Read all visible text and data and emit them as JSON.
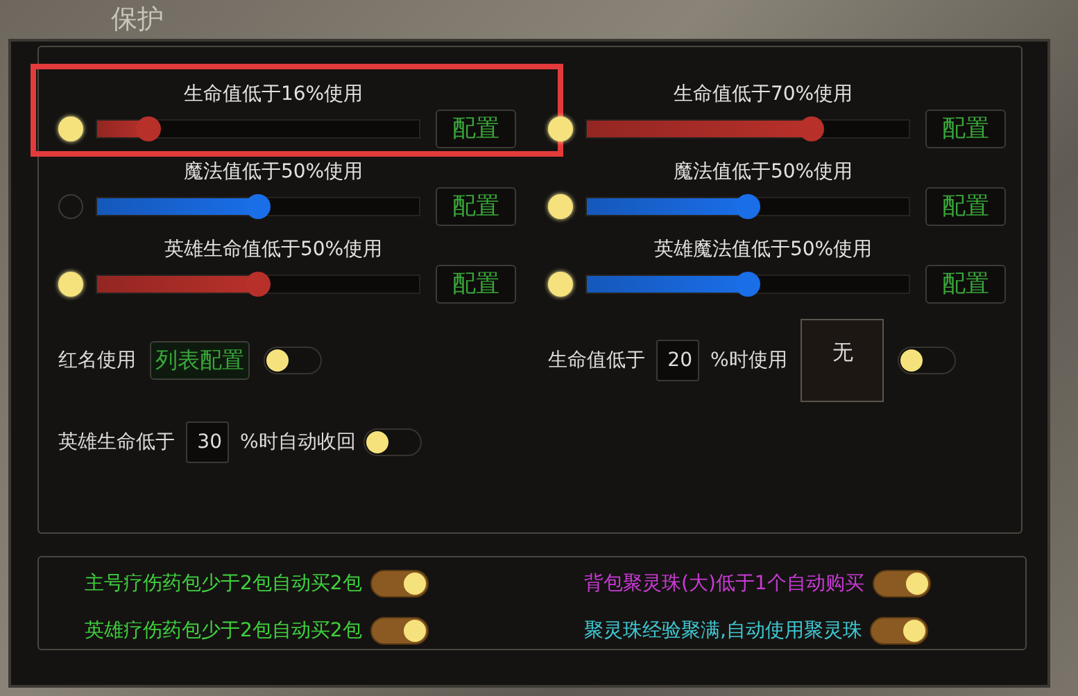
{
  "tab": {
    "label": "保护"
  },
  "sliders": [
    {
      "label": "生命值低于16%使用",
      "enabled": true,
      "level": 0.16,
      "color": "#b8302a",
      "button": "配置",
      "highlighted": true
    },
    {
      "label": "生命值低于70%使用",
      "enabled": true,
      "level": 0.7,
      "color": "#b8302a",
      "button": "配置",
      "highlighted": false
    },
    {
      "label": "魔法值低于50%使用",
      "enabled": false,
      "level": 0.5,
      "color": "#1a6ee8",
      "button": "配置",
      "highlighted": false
    },
    {
      "label": "魔法值低于50%使用",
      "enabled": true,
      "level": 0.5,
      "color": "#1a6ee8",
      "button": "配置",
      "highlighted": false
    },
    {
      "label": "英雄生命值低于50%使用",
      "enabled": true,
      "level": 0.5,
      "color": "#b8302a",
      "button": "配置",
      "highlighted": false
    },
    {
      "label": "英雄魔法值低于50%使用",
      "enabled": true,
      "level": 0.5,
      "color": "#1a6ee8",
      "button": "配置",
      "highlighted": false
    }
  ],
  "red_name": {
    "label": "红名使用",
    "button": "列表配置",
    "on": false
  },
  "hp_use": {
    "label": "生命值低于",
    "value": "20",
    "suffix": "%时使用",
    "slot": "无",
    "on": false
  },
  "hero_recall": {
    "label": "英雄生命低于",
    "value": "30",
    "suffix": "%时自动收回",
    "on": false
  },
  "auto_buy": [
    {
      "label": "主号疗伤药包少于2包自动买2包",
      "color": "#3fd23f",
      "on": true
    },
    {
      "label": "背包聚灵珠(大)低于1个自动购买",
      "color": "#c93bd6",
      "on": true
    },
    {
      "label": "英雄疗伤药包少于2包自动买2包",
      "color": "#3fd23f",
      "on": true
    },
    {
      "label": "聚灵珠经验聚满,自动使用聚灵珠",
      "color": "#3ec8d2",
      "on": true
    }
  ]
}
